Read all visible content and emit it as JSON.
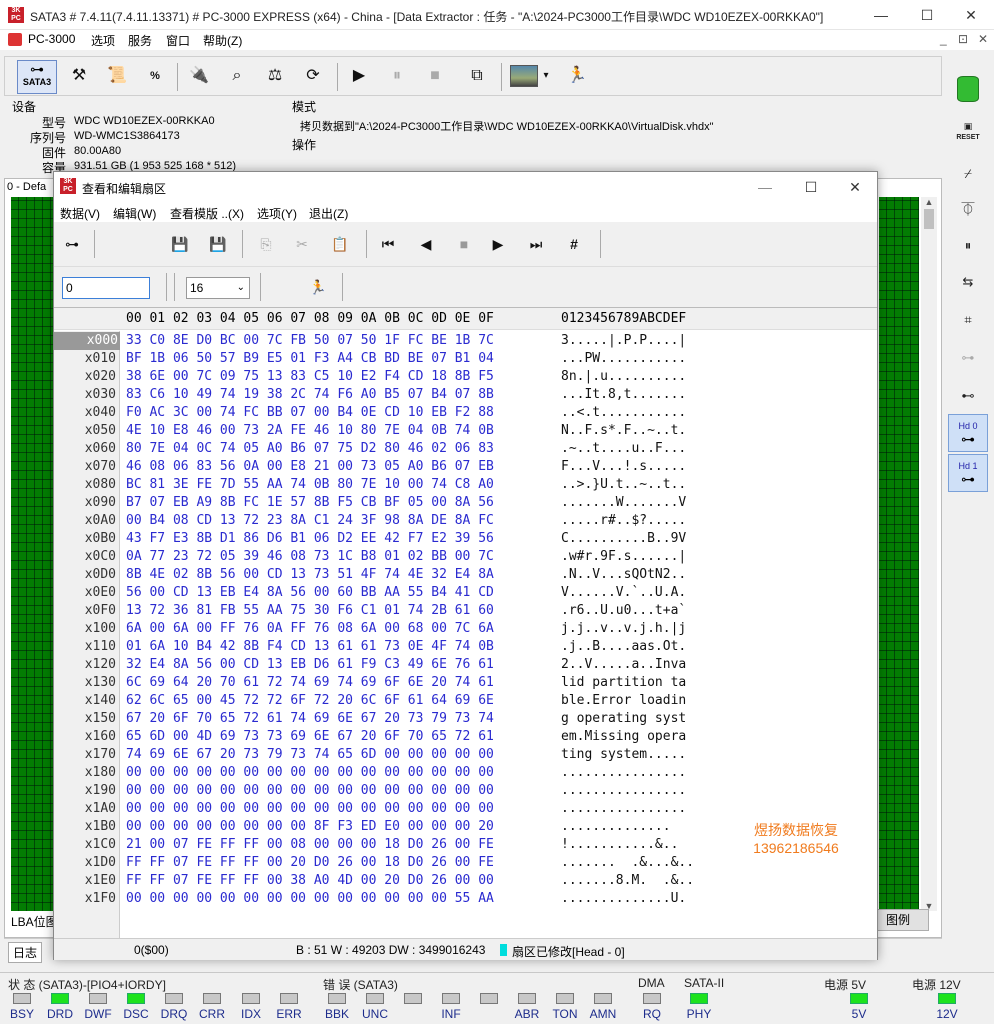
{
  "window": {
    "title": "SATA3 # 7.4.11(7.4.11.13371) # PC-3000 EXPRESS (x64) - China - [Data Extractor : 任务 - \"A:\\2024-PC3000工作目录\\WDC WD10EZEX-00RKKA0\"]",
    "minimize": "—",
    "maximize": "☐",
    "close": "✕"
  },
  "menubar": {
    "app": "PC-3000",
    "items": [
      "选项",
      "服务",
      "窗口",
      "帮助(Z)"
    ],
    "mdi": [
      "_",
      "⊡",
      "✕"
    ]
  },
  "toolbar": {
    "sata_label": "SATA3",
    "icons": [
      "connector-icon",
      "tools-icon",
      "scroll-icon",
      "percent-icon",
      "probe-icon",
      "binoculars-icon",
      "scale-icon",
      "sync-icon",
      "play-icon",
      "pause-icon",
      "stop-icon",
      "copy-icon",
      "image-icon",
      "runner-icon"
    ]
  },
  "device": {
    "section": "设备",
    "model_label": "型号",
    "model": "WDC WD10EZEX-00RKKA0",
    "serial_label": "序列号",
    "serial": "WD-WMC1S3864173",
    "firmware_label": "固件",
    "firmware": "80.00A80",
    "capacity_label": "容量",
    "capacity": "931.51 GB (1 953 525 168 * 512)"
  },
  "mode": {
    "section": "模式",
    "text": "拷贝数据到\"A:\\2024-PC3000工作目录\\WDC WD10EZEX-00RKKA0\\VirtualDisk.vhdx\"",
    "ops": "操作"
  },
  "task_tab": "0 - Defa",
  "lba_label": "LBA位图",
  "legend_label": "图例",
  "log_tab": "日志",
  "dialog": {
    "title": "查看和编辑扇区",
    "menu": [
      "数据(V)",
      "编辑(W)",
      "查看模版 ..(X)",
      "选项(Y)",
      "退出(Z)"
    ],
    "sector_input": "0",
    "bytes_per_row": "16",
    "hex_header": "00 01 02 03 04 05 06 07 08 09 0A 0B 0C 0D 0E 0F",
    "ascii_header": "0123456789ABCDEF",
    "rows": [
      {
        "off": "x000",
        "hex": "33 C0 8E D0 BC 00 7C FB 50 07 50 1F FC BE 1B 7C",
        "asc": "3.....|.P.P....|"
      },
      {
        "off": "x010",
        "hex": "BF 1B 06 50 57 B9 E5 01 F3 A4 CB BD BE 07 B1 04",
        "asc": "...PW..........."
      },
      {
        "off": "x020",
        "hex": "38 6E 00 7C 09 75 13 83 C5 10 E2 F4 CD 18 8B F5",
        "asc": "8n.|.u.........."
      },
      {
        "off": "x030",
        "hex": "83 C6 10 49 74 19 38 2C 74 F6 A0 B5 07 B4 07 8B",
        "asc": "...It.8,t......."
      },
      {
        "off": "x040",
        "hex": "F0 AC 3C 00 74 FC BB 07 00 B4 0E CD 10 EB F2 88",
        "asc": "..<.t..........."
      },
      {
        "off": "x050",
        "hex": "4E 10 E8 46 00 73 2A FE 46 10 80 7E 04 0B 74 0B",
        "asc": "N..F.s*.F..~..t."
      },
      {
        "off": "x060",
        "hex": "80 7E 04 0C 74 05 A0 B6 07 75 D2 80 46 02 06 83",
        "asc": ".~..t....u..F..."
      },
      {
        "off": "x070",
        "hex": "46 08 06 83 56 0A 00 E8 21 00 73 05 A0 B6 07 EB",
        "asc": "F...V...!.s....."
      },
      {
        "off": "x080",
        "hex": "BC 81 3E FE 7D 55 AA 74 0B 80 7E 10 00 74 C8 A0",
        "asc": "..>.}U.t..~..t.."
      },
      {
        "off": "x090",
        "hex": "B7 07 EB A9 8B FC 1E 57 8B F5 CB BF 05 00 8A 56",
        "asc": ".......W.......V"
      },
      {
        "off": "x0A0",
        "hex": "00 B4 08 CD 13 72 23 8A C1 24 3F 98 8A DE 8A FC",
        "asc": ".....r#..$?....."
      },
      {
        "off": "x0B0",
        "hex": "43 F7 E3 8B D1 86 D6 B1 06 D2 EE 42 F7 E2 39 56",
        "asc": "C..........B..9V"
      },
      {
        "off": "x0C0",
        "hex": "0A 77 23 72 05 39 46 08 73 1C B8 01 02 BB 00 7C",
        "asc": ".w#r.9F.s......|"
      },
      {
        "off": "x0D0",
        "hex": "8B 4E 02 8B 56 00 CD 13 73 51 4F 74 4E 32 E4 8A",
        "asc": ".N..V...sQOtN2.."
      },
      {
        "off": "x0E0",
        "hex": "56 00 CD 13 EB E4 8A 56 00 60 BB AA 55 B4 41 CD",
        "asc": "V......V.`..U.A."
      },
      {
        "off": "x0F0",
        "hex": "13 72 36 81 FB 55 AA 75 30 F6 C1 01 74 2B 61 60",
        "asc": ".r6..U.u0...t+a`"
      },
      {
        "off": "x100",
        "hex": "6A 00 6A 00 FF 76 0A FF 76 08 6A 00 68 00 7C 6A",
        "asc": "j.j..v..v.j.h.|j"
      },
      {
        "off": "x110",
        "hex": "01 6A 10 B4 42 8B F4 CD 13 61 61 73 0E 4F 74 0B",
        "asc": ".j..B....aas.Ot."
      },
      {
        "off": "x120",
        "hex": "32 E4 8A 56 00 CD 13 EB D6 61 F9 C3 49 6E 76 61",
        "asc": "2..V.....a..Inva"
      },
      {
        "off": "x130",
        "hex": "6C 69 64 20 70 61 72 74 69 74 69 6F 6E 20 74 61",
        "asc": "lid partition ta"
      },
      {
        "off": "x140",
        "hex": "62 6C 65 00 45 72 72 6F 72 20 6C 6F 61 64 69 6E",
        "asc": "ble.Error loadin"
      },
      {
        "off": "x150",
        "hex": "67 20 6F 70 65 72 61 74 69 6E 67 20 73 79 73 74",
        "asc": "g operating syst"
      },
      {
        "off": "x160",
        "hex": "65 6D 00 4D 69 73 73 69 6E 67 20 6F 70 65 72 61",
        "asc": "em.Missing opera"
      },
      {
        "off": "x170",
        "hex": "74 69 6E 67 20 73 79 73 74 65 6D 00 00 00 00 00",
        "asc": "ting system....."
      },
      {
        "off": "x180",
        "hex": "00 00 00 00 00 00 00 00 00 00 00 00 00 00 00 00",
        "asc": "................"
      },
      {
        "off": "x190",
        "hex": "00 00 00 00 00 00 00 00 00 00 00 00 00 00 00 00",
        "asc": "................"
      },
      {
        "off": "x1A0",
        "hex": "00 00 00 00 00 00 00 00 00 00 00 00 00 00 00 00",
        "asc": "................"
      },
      {
        "off": "x1B0",
        "hex": "00 00 00 00 00 00 00 00 8F F3 ED E0 00 00 00 20",
        "asc": "..............  "
      },
      {
        "off": "x1C0",
        "hex": "21 00 07 FE FF FF 00 08 00 00 00 18 D0 26 00 FE",
        "asc": "!...........&.. "
      },
      {
        "off": "x1D0",
        "hex": "FF FF 07 FE FF FF 00 20 D0 26 00 18 D0 26 00 FE",
        "asc": ".......  .&...&.."
      },
      {
        "off": "x1E0",
        "hex": "FF FF 07 FE FF FF 00 38 A0 4D 00 20 D0 26 00 00",
        "asc": ".......8.M.  .&.."
      },
      {
        "off": "x1F0",
        "hex": "00 00 00 00 00 00 00 00 00 00 00 00 00 00 55 AA",
        "asc": "..............U."
      }
    ],
    "watermark_line1": "煜扬数据恢复",
    "watermark_line2": "13962186546",
    "status_offset": "0($00)",
    "status_values": "B : 51 W : 49203 DW : 3499016243",
    "status_modified": "扇区已修改[Head - 0]"
  },
  "statusbar": {
    "state_label": "状 态 (SATA3)-[PIO4+IORDY]",
    "error_label": "错 误 (SATA3)",
    "dma_label": "DMA",
    "sata_label": "SATA-II",
    "power5_label": "电源 5V",
    "power12_label": "电源 12V",
    "state_leds": [
      "BSY",
      "DRD",
      "DWF",
      "DSC",
      "DRQ",
      "CRR",
      "IDX",
      "ERR"
    ],
    "error_leds": [
      "BBK",
      "UNC",
      "",
      "INF",
      "",
      "ABR",
      "TON",
      "AMN"
    ],
    "rq": "RQ",
    "phy": "PHY",
    "v5": "5V",
    "v12": "12V"
  },
  "right_toolbar": {
    "hd0": "Hd 0",
    "hd1": "Hd 1",
    "reset": "RESET"
  }
}
